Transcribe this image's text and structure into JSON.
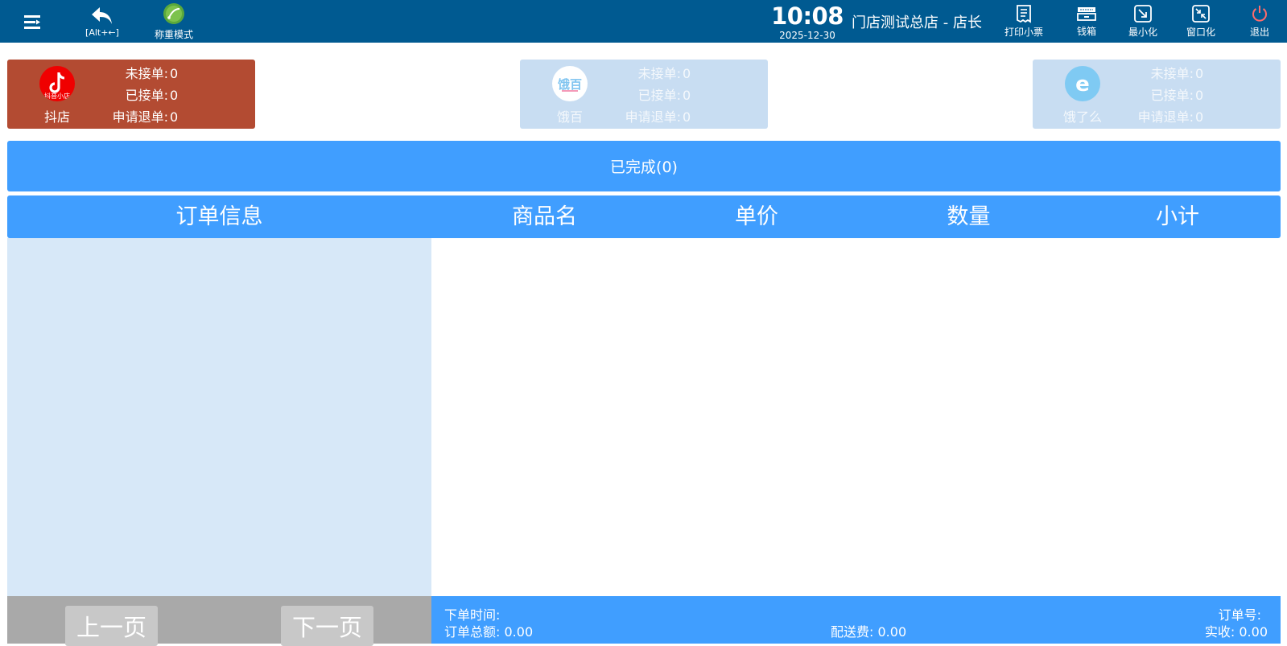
{
  "topbar": {
    "back_label": "[Alt+←]",
    "weigh_label": "称重模式",
    "time": "10:08",
    "date": "2025-12-30",
    "store": "门店测试总店 - 店长",
    "print_label": "打印小票",
    "cashbox_label": "钱箱",
    "minimize_label": "最小化",
    "window_label": "窗口化",
    "exit_label": "退出"
  },
  "platforms": [
    {
      "name": "抖店",
      "logo_text": "抖音小店",
      "pending_label": "未接单:",
      "pending": "0",
      "accepted_label": "已接单:",
      "accepted": "0",
      "refund_label": "申请退单:",
      "refund": "0"
    },
    {
      "name": "饿百",
      "logo_text": "饿百",
      "pending_label": "未接单:",
      "pending": "0",
      "accepted_label": "已接单:",
      "accepted": "0",
      "refund_label": "申请退单:",
      "refund": "0"
    },
    {
      "name": "饿了么",
      "logo_text": "e",
      "pending_label": "未接单:",
      "pending": "0",
      "accepted_label": "已接单:",
      "accepted": "0",
      "refund_label": "申请退单:",
      "refund": "0"
    }
  ],
  "status_bar": "已完成(0)",
  "table": {
    "columns": [
      "订单信息",
      "商品名",
      "单价",
      "数量",
      "小计"
    ]
  },
  "pager": {
    "prev": "上一页",
    "next": "下一页"
  },
  "footer": {
    "order_time_label": "下单时间:",
    "order_no_label": "订单号:",
    "total_label": "订单总额:",
    "total": "0.00",
    "delivery_label": "配送费:",
    "delivery": "0.00",
    "paid_label": "实收:",
    "paid": "0.00"
  },
  "colors": {
    "topbar": "#005a91",
    "accent": "#409eff",
    "active_card": "#b34b32",
    "inactive_card": "#c8ddf2",
    "exit_icon": "#ff6b6b"
  }
}
